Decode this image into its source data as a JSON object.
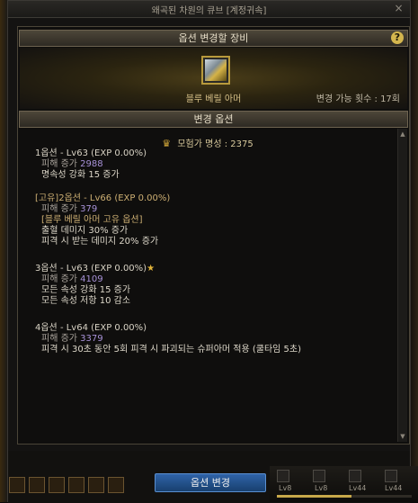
{
  "window": {
    "title": "왜곡된 차원의 큐브 [계정귀속]",
    "close_label": "×"
  },
  "equipment": {
    "section_title": "옵션 변경할 장비",
    "help_label": "?",
    "item_name": "블루 베릴 아머",
    "change_count": "변경 가능 횟수 : 17회"
  },
  "options": {
    "section_title": "변경 옵션",
    "fame": "모험가 명성 : 2375",
    "items": [
      {
        "header": "1옵션 - Lv63 (EXP 0.00%)",
        "damage_label": "피해 증가",
        "damage_value": "2988",
        "lines": [
          "명속성 강화 15 증가"
        ]
      },
      {
        "header": "[고유]2옵션 - Lv66 (EXP 0.00%)",
        "damage_label": "피해 증가",
        "damage_value": "379",
        "sub": "[블루 베릴 아머 고유 옵션]",
        "lines": [
          "출혈 데미지 30% 증가",
          "피격 시 받는 데미지 20% 증가"
        ]
      },
      {
        "header": "3옵션 - Lv63 (EXP 0.00%)",
        "star": "★",
        "damage_label": "피해 증가",
        "damage_value": "4109",
        "lines": [
          "모든 속성 강화 15 증가",
          "모든 속성 저항 10 감소"
        ]
      },
      {
        "header": "4옵션 - Lv64 (EXP 0.00%)",
        "damage_label": "피해 증가",
        "damage_value": "3379",
        "lines": [
          "피격 시 30초 동안 5회 피격 시 파괴되는 슈퍼아머 적용 (쿨타임 5초)"
        ]
      }
    ]
  },
  "footer": {
    "change_button": "옵션 변경"
  },
  "hud": {
    "levels": [
      "Lv8",
      "Lv8",
      "Lv44",
      "Lv44"
    ],
    "progress": 0.55
  },
  "colors": {
    "accent_gold": "#d4b64e",
    "button_blue": "#2f63a8",
    "value_purple": "#a892d8"
  }
}
